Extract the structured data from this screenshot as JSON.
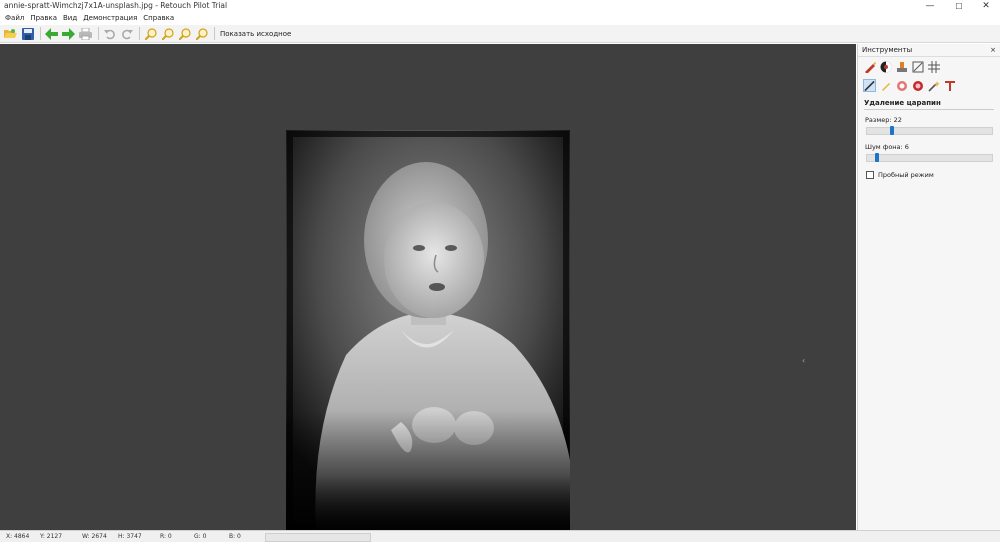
{
  "window": {
    "title": "annie-spratt-Wimchzj7x1A-unsplash.jpg - Retouch Pilot Trial",
    "minimize": "—",
    "maximize": "☐",
    "close": "✕"
  },
  "menu": [
    "Файл",
    "Правка",
    "Вид",
    "Демонстрация",
    "Справка"
  ],
  "toolbar": {
    "show_original": "Показать исходное",
    "icons": [
      "open-icon",
      "save-icon",
      "back-arrow-icon",
      "forward-arrow-icon",
      "print-icon",
      "undo-icon",
      "redo-icon",
      "zoom-in-icon",
      "zoom-out-icon",
      "zoom-fit-icon",
      "zoom-actual-icon"
    ]
  },
  "panel": {
    "title": "Инструменты",
    "close": "×",
    "section": "Удаление царапин",
    "size_label": "Размер: 22",
    "size_value_fraction": 0.18,
    "noise_label": "Шум фона: 6",
    "noise_value_fraction": 0.06,
    "test_mode_label": "Пробный режим",
    "test_mode_checked": false
  },
  "status": {
    "x": "X: 4864",
    "y": "Y: 2127",
    "w": "W: 2674",
    "h": "H: 3747",
    "r": "R: 0",
    "g": "G: 0",
    "b": "B: 0"
  },
  "colors": {
    "canvas_bg": "#3f3f3f",
    "accent": "#1b76c9",
    "green_arrow": "#3aaa35"
  }
}
